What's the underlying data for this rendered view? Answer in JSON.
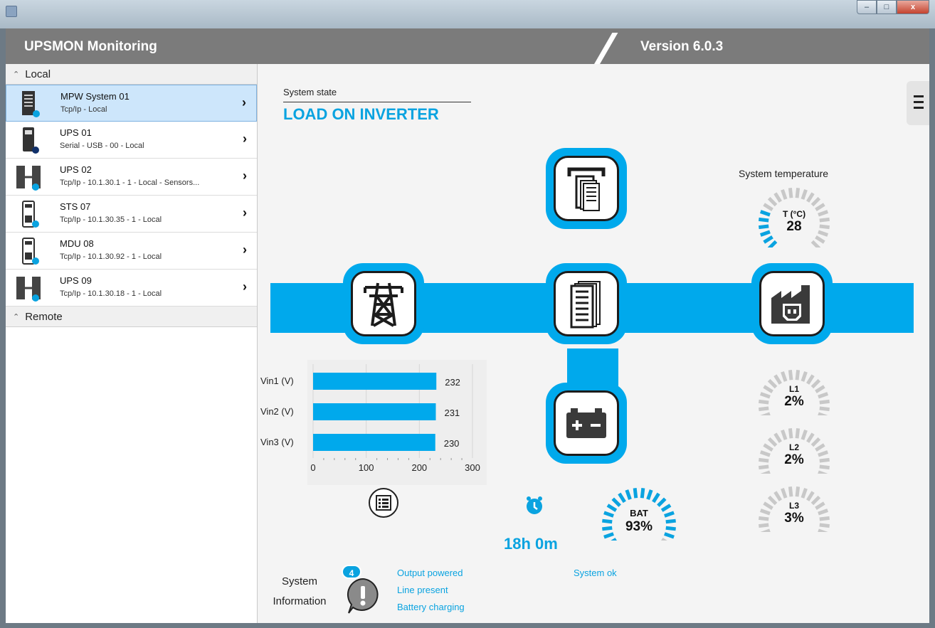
{
  "window": {
    "minimize_glyph": "–",
    "maximize_glyph": "□",
    "close_glyph": "x"
  },
  "header": {
    "app_title": "UPSMON Monitoring",
    "version": "Version 6.0.3"
  },
  "sidebar": {
    "local_label": "Local",
    "remote_label": "Remote",
    "devices": [
      {
        "name": "MPW System 01",
        "sub": "Tcp/Ip - Local",
        "icon": "modular-ups-icon",
        "selected": true
      },
      {
        "name": "UPS 01",
        "sub": "Serial - USB - 00 - Local",
        "icon": "tower-ups-icon",
        "selected": false
      },
      {
        "name": "UPS 02",
        "sub": "Tcp/Ip - 10.1.30.1 - 1 - Local - Sensors...",
        "icon": "parallel-ups-icon",
        "selected": false
      },
      {
        "name": "STS 07",
        "sub": "Tcp/Ip - 10.1.30.35 - 1 - Local",
        "icon": "sts-icon",
        "selected": false
      },
      {
        "name": "MDU 08",
        "sub": "Tcp/Ip - 10.1.30.92 - 1 - Local",
        "icon": "mdu-icon",
        "selected": false
      },
      {
        "name": "UPS 09",
        "sub": "Tcp/Ip - 10.1.30.18 - 1 - Local",
        "icon": "parallel-ups-icon",
        "selected": false
      }
    ]
  },
  "main": {
    "state_label": "System state",
    "state_value": "LOAD ON INVERTER",
    "temperature_title": "System temperature",
    "temperature": {
      "label": "T (°C)",
      "value": "28",
      "fraction": 0.28
    },
    "loads": [
      {
        "label": "L1",
        "value": "2%",
        "fraction": 0.02
      },
      {
        "label": "L2",
        "value": "2%",
        "fraction": 0.02
      },
      {
        "label": "L3",
        "value": "3%",
        "fraction": 0.03
      }
    ],
    "battery": {
      "label": "BAT",
      "value": "93%",
      "fraction": 0.93
    },
    "runtime": "18h 0m",
    "system_info_line1": "System",
    "system_info_line2": "Information",
    "alert_count": "4",
    "messages_left": [
      "Output powered",
      "Line present",
      "Battery charging"
    ],
    "messages_right": [
      "System ok"
    ],
    "accent_color": "#00a9ec"
  },
  "chart_data": {
    "type": "bar",
    "orientation": "horizontal",
    "categories": [
      "Vin1 (V)",
      "Vin2 (V)",
      "Vin3 (V)"
    ],
    "values": [
      232,
      231,
      230
    ],
    "xlim": [
      0,
      300
    ],
    "xticks": [
      "0",
      "100",
      "200",
      "300"
    ],
    "grid": true
  }
}
